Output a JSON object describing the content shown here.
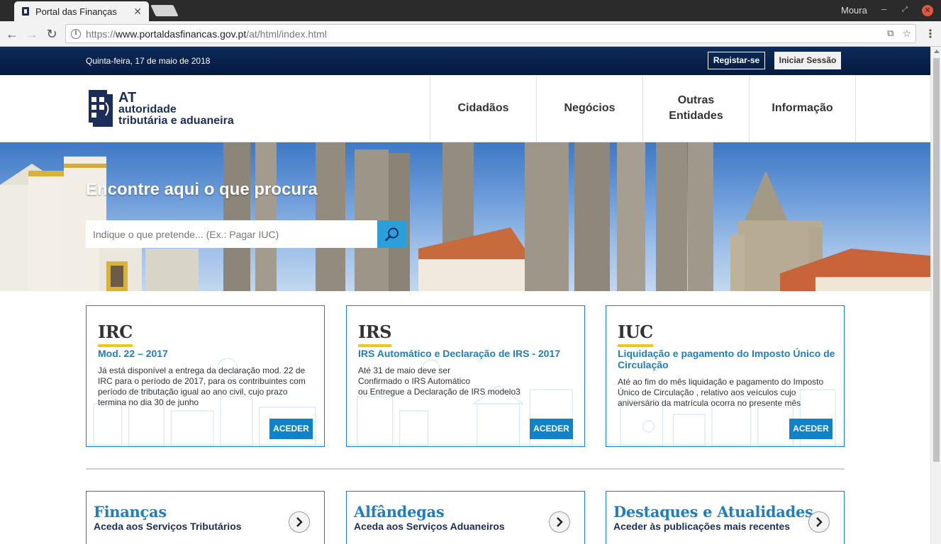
{
  "browser": {
    "tab_title": "Portal das Finanças",
    "profile_name": "Moura",
    "url_prefix": "https://",
    "url_host": "www.portaldasfinancas.gov.pt",
    "url_path": "/at/html/index.html"
  },
  "topbar": {
    "date": "Quinta-feira, 17 de maio de 2018",
    "register_label": "Registar-se",
    "login_label": "Iniciar Sessão"
  },
  "logo": {
    "line1": "AT",
    "line2": "autoridade",
    "line3": "tributária e aduaneira"
  },
  "nav": {
    "items": [
      {
        "label": "Cidadãos"
      },
      {
        "label": "Negócios"
      },
      {
        "label": "Outras Entidades"
      },
      {
        "label": "Informação"
      }
    ]
  },
  "hero": {
    "title": "Encontre aqui o que procura",
    "search_placeholder": "Indique o que pretende... (Ex.: Pagar IUC)"
  },
  "cards": [
    {
      "tag": "IRC",
      "title": "Mod. 22 – 2017",
      "text": "Já está disponível a entrega da declaração mod. 22 de IRC para o período de 2017, para os contribuintes com período de tributação igual ao ano civil, cujo prazo termina no dia 30 de junho",
      "button": "ACEDER"
    },
    {
      "tag": "IRS",
      "title": "IRS Automático e Declaração de IRS - 2017",
      "text_lines": [
        "Até 31 de maio deve ser",
        "Confirmado o IRS Automático",
        "ou Entregue a Declaração de IRS modelo3"
      ],
      "button": "ACEDER"
    },
    {
      "tag": "IUC",
      "title": "Liquidação e pagamento do Imposto Único de Circulação",
      "text": "Até ao fim do mês liquidação e pagamento do Imposto Único de Circulação , relativo aos veículos cujo aniversário da matrícula ocorra no presente mês",
      "button": "ACEDER"
    }
  ],
  "bottom_cards": [
    {
      "title": "Finanças",
      "subtitle": "Aceda aos Serviços Tributários"
    },
    {
      "title": "Alfândegas",
      "subtitle": "Aceda aos Serviços Aduaneiros"
    },
    {
      "title": "Destaques e Atualidades",
      "subtitle": "Aceder às publicações mais recentes"
    }
  ],
  "colors": {
    "topbar": "#041b40",
    "brand_navy": "#1c2d5a",
    "accent_blue": "#1d7fc1",
    "button_blue": "#0f83c9",
    "search_blue": "#2b9fd9",
    "tag_underline": "#f5c518"
  },
  "icons": {
    "search": "magnifier-icon",
    "arrow": "chevron-right-icon"
  }
}
